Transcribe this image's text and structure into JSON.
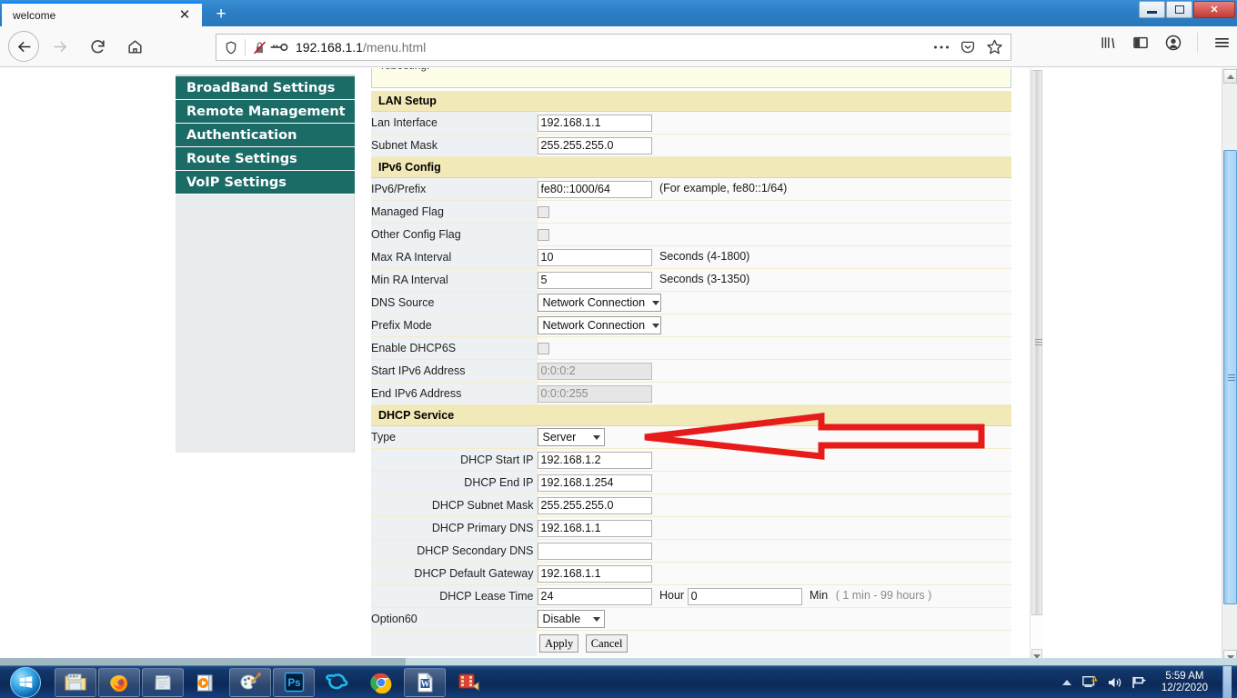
{
  "browser": {
    "tab_title": "welcome",
    "close_tab_glyph": "✕",
    "new_tab_glyph": "+",
    "url_host": "192.168.1.1",
    "url_path": "/menu.html",
    "icons": {
      "back": "back-arrow-icon",
      "forward": "forward-arrow-icon",
      "reload": "reload-icon",
      "home": "home-icon",
      "shield": "tracking-protection-shield-icon",
      "insecure_lock": "insecure-lock-icon",
      "key": "login-key-icon",
      "page_actions": "ellipsis-icon",
      "pocket": "pocket-save-icon",
      "bookmark": "star-bookmark-icon",
      "library": "library-icon",
      "sidebar": "sidebar-toggle-icon",
      "account": "account-icon",
      "menu": "hamburger-menu-icon"
    }
  },
  "window": {
    "minimize": "minimize-button",
    "restore": "restore-button",
    "close_glyph": "✕"
  },
  "sidebar": {
    "items": [
      {
        "label": "BroadBand Settings"
      },
      {
        "label": "Remote Management"
      },
      {
        "label": "Authentication"
      },
      {
        "label": "Route Settings"
      },
      {
        "label": "VoIP Settings"
      }
    ]
  },
  "sections": {
    "lan_setup": {
      "title": "LAN Setup",
      "rows": [
        {
          "label": "Lan Interface",
          "value": "192.168.1.1"
        },
        {
          "label": "Subnet Mask",
          "value": "255.255.255.0"
        }
      ]
    },
    "ipv6_config": {
      "title": "IPv6 Config",
      "prefix_label": "IPv6/Prefix",
      "prefix_value": "fe80::1000/64",
      "prefix_hint": "(For example, fe80::1/64)",
      "managed_flag_label": "Managed Flag",
      "other_config_flag_label": "Other Config Flag",
      "max_ra_label": "Max RA Interval",
      "max_ra_value": "10",
      "max_ra_unit": "Seconds (4-1800)",
      "min_ra_label": "Min RA Interval",
      "min_ra_value": "5",
      "min_ra_unit": "Seconds (3-1350)",
      "dns_source_label": "DNS Source",
      "dns_source_value": "Network Connection",
      "prefix_mode_label": "Prefix Mode",
      "prefix_mode_value": "Network Connection",
      "enable_dhcp6s_label": "Enable DHCP6S",
      "start_ipv6_label": "Start IPv6 Address",
      "start_ipv6_value": "0:0:0:2",
      "end_ipv6_label": "End IPv6 Address",
      "end_ipv6_value": "0:0:0:255"
    },
    "dhcp_service": {
      "title": "DHCP Service",
      "type_label": "Type",
      "type_value": "Server",
      "rows": [
        {
          "label": "DHCP Start IP",
          "value": "192.168.1.2"
        },
        {
          "label": "DHCP End IP",
          "value": "192.168.1.254"
        },
        {
          "label": "DHCP Subnet Mask",
          "value": "255.255.255.0"
        },
        {
          "label": "DHCP Primary DNS",
          "value": "192.168.1.1"
        },
        {
          "label": "DHCP Secondary DNS",
          "value": ""
        },
        {
          "label": "DHCP Default Gateway",
          "value": "192.168.1.1"
        }
      ],
      "lease_label": "DHCP Lease Time",
      "lease_hours": "24",
      "lease_hour_unit": "Hour",
      "lease_mins": "0",
      "lease_min_unit": "Min",
      "lease_hint": "( 1 min - 99 hours )",
      "option60_label": "Option60",
      "option60_value": "Disable"
    },
    "buttons": {
      "apply": "Apply",
      "cancel": "Cancel"
    }
  },
  "annotation": {
    "name": "red-arrow-pointing-to-dhcp-type",
    "color": "#e81b1b",
    "direction": "left"
  },
  "taskbar": {
    "start": "windows-start-orb",
    "items": [
      {
        "name": "file-explorer"
      },
      {
        "name": "firefox"
      },
      {
        "name": "notepad"
      },
      {
        "name": "media-player"
      },
      {
        "name": "paint"
      },
      {
        "name": "photoshop",
        "text": "Ps"
      },
      {
        "name": "internet-explorer"
      },
      {
        "name": "google-chrome"
      },
      {
        "name": "microsoft-word",
        "text": "W"
      },
      {
        "name": "movie-maker"
      }
    ],
    "tray": {
      "expand": "show-hidden-icons",
      "action_center": "action-center-warning-icon",
      "volume": "volume-icon",
      "network": "network-flag-icon",
      "time": "5:59 AM",
      "date": "12/2/2020"
    }
  }
}
